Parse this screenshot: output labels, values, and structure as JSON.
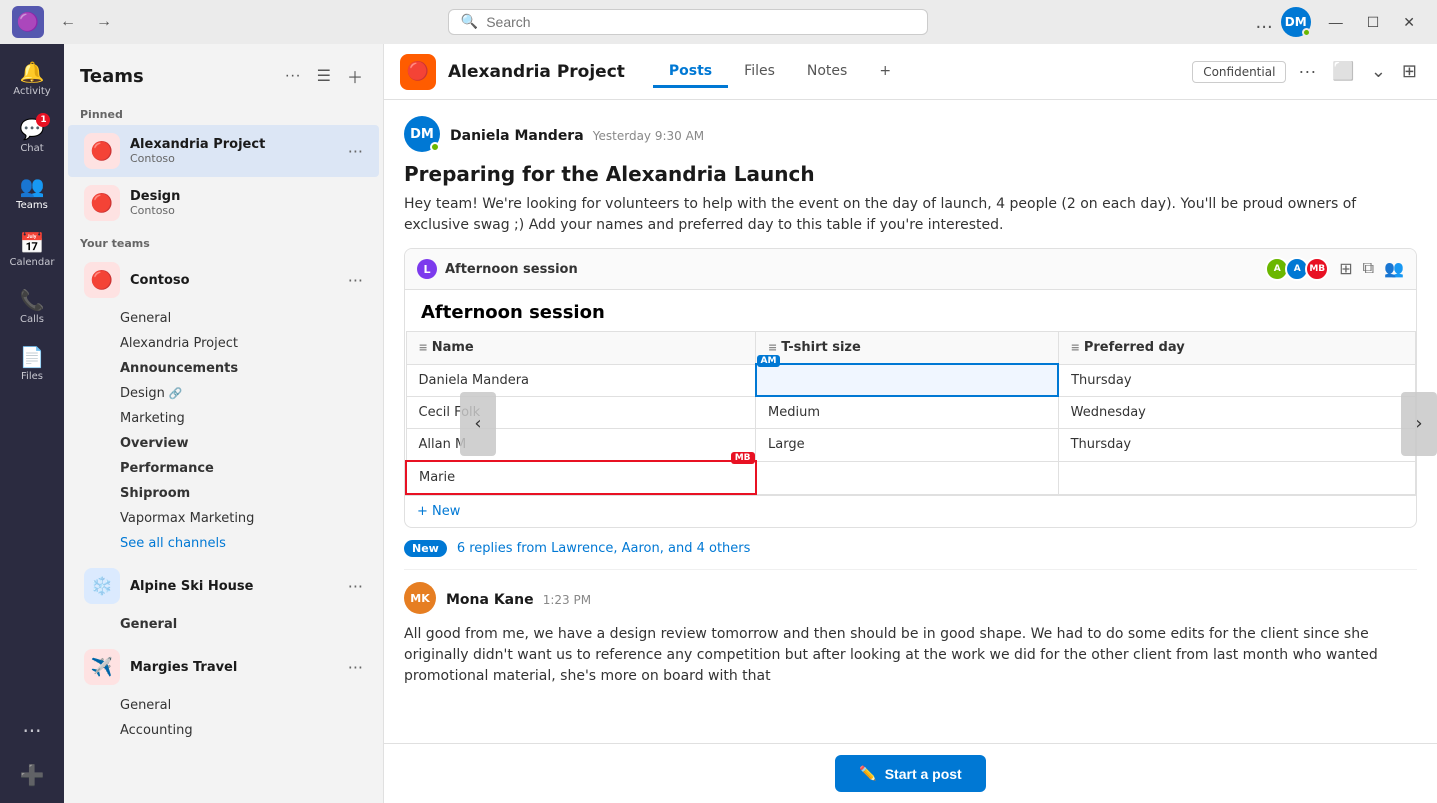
{
  "titlebar": {
    "search_placeholder": "Search",
    "dots_label": "...",
    "minimize": "—",
    "maximize": "☐",
    "close": "✕",
    "avatar_initials": "DM"
  },
  "nav_rail": {
    "items": [
      {
        "id": "activity",
        "label": "Activity",
        "icon": "🔔",
        "badge": null
      },
      {
        "id": "chat",
        "label": "Chat",
        "icon": "💬",
        "badge": "1"
      },
      {
        "id": "teams",
        "label": "Teams",
        "icon": "👥",
        "badge": null
      },
      {
        "id": "calendar",
        "label": "Calendar",
        "icon": "📅",
        "badge": null
      },
      {
        "id": "calls",
        "label": "Calls",
        "icon": "📞",
        "badge": null
      },
      {
        "id": "files",
        "label": "Files",
        "icon": "📄",
        "badge": null
      }
    ],
    "more_label": "...",
    "apps_label": "Apps"
  },
  "sidebar": {
    "title": "Teams",
    "pinned_label": "Pinned",
    "your_teams_label": "Your teams",
    "teams": [
      {
        "id": "alexandria-project",
        "name": "Alexandria Project",
        "org": "Contoso",
        "color": "#c0392b",
        "icon": "🔴",
        "active": true,
        "channels": [
          {
            "name": "General",
            "bold": false
          },
          {
            "name": "Alexandria Project",
            "bold": false
          },
          {
            "name": "Announcements",
            "bold": true
          },
          {
            "name": "Design",
            "bold": false
          },
          {
            "name": "Marketing",
            "bold": false
          },
          {
            "name": "Overview",
            "bold": true
          },
          {
            "name": "Performance",
            "bold": true
          },
          {
            "name": "Shiproom",
            "bold": true
          },
          {
            "name": "Vapormax Marketing",
            "bold": false
          }
        ],
        "see_all": "See all channels"
      }
    ],
    "other_teams": [
      {
        "id": "contoso",
        "name": "Contoso",
        "org": "",
        "color": "#c0392b"
      },
      {
        "id": "alpine-ski-house",
        "name": "Alpine Ski House",
        "org": "",
        "color": "#1e6bbf",
        "channels": [
          {
            "name": "General",
            "bold": true
          }
        ]
      },
      {
        "id": "margies-travel",
        "name": "Margies Travel",
        "org": "",
        "color": "#c0392b",
        "channels": [
          {
            "name": "General",
            "bold": false
          },
          {
            "name": "Accounting",
            "bold": false
          }
        ]
      }
    ]
  },
  "channel_header": {
    "team_name": "Alexandria Project",
    "tabs": [
      "Posts",
      "Files",
      "Notes"
    ],
    "active_tab": "Posts",
    "confidential_label": "Confidential",
    "add_tab": "+"
  },
  "post": {
    "author": "Daniela Mandera",
    "author_initials": "DM",
    "time": "Yesterday 9:30 AM",
    "title": "Preparing for the Alexandria Launch",
    "body": "Hey team! We're looking for volunteers to help with the event on the day of launch, 4 people (2 on each day). You'll be proud owners of exclusive swag ;) Add your names and preferred day to this table if you're interested.",
    "loop": {
      "icon_label": "L",
      "title": "Afternoon session",
      "table_title": "Afternoon session",
      "avatars": [
        {
          "initials": "A1",
          "color": "#6bb700"
        },
        {
          "initials": "A2",
          "color": "#0078d4"
        },
        {
          "initials": "MB",
          "color": "#e81123"
        }
      ],
      "columns": [
        "Name",
        "T-shirt size",
        "Preferred day"
      ],
      "rows": [
        {
          "name": "Daniela Mandera",
          "tshirt": "",
          "day": "Thursday",
          "name_cursor": "AM",
          "tshirt_active": true
        },
        {
          "name": "Cecil Folk",
          "tshirt": "Medium",
          "day": "Wednesday"
        },
        {
          "name": "Allan M",
          "tshirt": "Large",
          "day": "Thursday"
        },
        {
          "name": "Marie",
          "tshirt": "",
          "day": "",
          "name_red_border": true,
          "mb_cursor": "MB"
        }
      ],
      "add_row_label": "+ New"
    },
    "new_badge": "New",
    "replies_text": "6 replies from Lawrence, Aaron, and 4 others"
  },
  "reply": {
    "author": "Mona Kane",
    "author_initials": "MK",
    "time": "1:23 PM",
    "body": "All good from me, we have a design review tomorrow and then should be in good shape. We had to do some edits for the client since she originally didn't want us to reference any competition but after looking at the work we did for the other client from last month who wanted promotional material, she's more on board with that"
  },
  "compose": {
    "start_post_label": "Start a post"
  }
}
